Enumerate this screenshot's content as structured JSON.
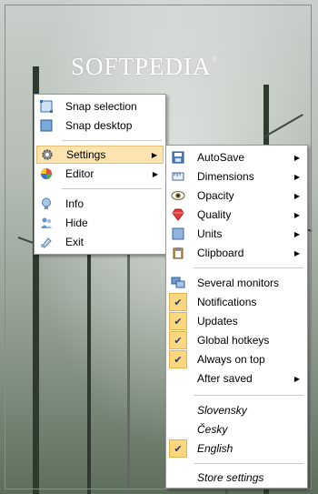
{
  "watermark": {
    "logo": "SOFTPEDIA",
    "mark": "®"
  },
  "main_menu": {
    "items": [
      {
        "label": "Snap selection",
        "icon": "snap-selection-icon"
      },
      {
        "label": "Snap desktop",
        "icon": "snap-desktop-icon"
      },
      {
        "label": "Settings",
        "icon": "gear-icon",
        "highlighted": true,
        "submenu": true
      },
      {
        "label": "Editor",
        "icon": "color-wheel-icon",
        "submenu": true
      },
      {
        "label": "Info",
        "icon": "lightbulb-icon"
      },
      {
        "label": "Hide",
        "icon": "people-icon"
      },
      {
        "label": "Exit",
        "icon": "exit-icon"
      }
    ]
  },
  "settings_menu": {
    "items": [
      {
        "label": "AutoSave",
        "icon": "save-icon",
        "submenu": true
      },
      {
        "label": "Dimensions",
        "icon": "ruler-icon",
        "submenu": true
      },
      {
        "label": "Opacity",
        "icon": "eye-icon",
        "submenu": true
      },
      {
        "label": "Quality",
        "icon": "gem-icon",
        "submenu": true
      },
      {
        "label": "Units",
        "icon": "units-icon",
        "submenu": true
      },
      {
        "label": "Clipboard",
        "icon": "clipboard-icon",
        "submenu": true
      },
      {
        "label": "Several monitors",
        "icon": "monitors-icon",
        "checked": false
      },
      {
        "label": "Notifications",
        "checked": true
      },
      {
        "label": "Updates",
        "checked": true
      },
      {
        "label": "Global hotkeys",
        "checked": true
      },
      {
        "label": "Always on top",
        "checked": true
      },
      {
        "label": "After saved",
        "submenu": true
      },
      {
        "label": "Slovensky",
        "lang": true
      },
      {
        "label": "Česky",
        "lang": true
      },
      {
        "label": "English",
        "lang": true,
        "checked": true
      },
      {
        "label": "Store settings",
        "lang": true
      }
    ]
  },
  "colors": {
    "highlight": "#fce4b0",
    "check_bg": "#fbd77f"
  }
}
